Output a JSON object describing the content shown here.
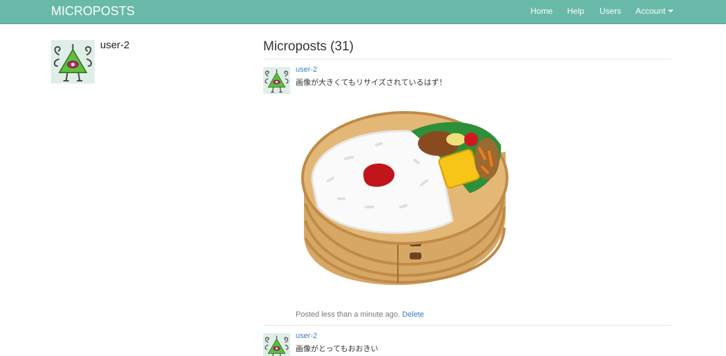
{
  "navbar": {
    "brand": "MICROPOSTS",
    "links": [
      {
        "label": "Home"
      },
      {
        "label": "Help"
      },
      {
        "label": "Users"
      },
      {
        "label": "Account"
      }
    ]
  },
  "profile": {
    "name": "user-2",
    "avatar_icon": "green-triangle-monster-icon"
  },
  "microposts": {
    "heading": "Microposts (31)",
    "items": [
      {
        "user": "user-2",
        "content": "画像が大きくてもリサイズされているはず！",
        "image": "bento-box-image",
        "posted": "Posted less than a minute ago.",
        "delete_label": "Delete"
      },
      {
        "user": "user-2",
        "content": "画像がとってもおおきい"
      }
    ]
  },
  "colors": {
    "navbar": "#69b9a9",
    "link": "#3a7dbf"
  }
}
